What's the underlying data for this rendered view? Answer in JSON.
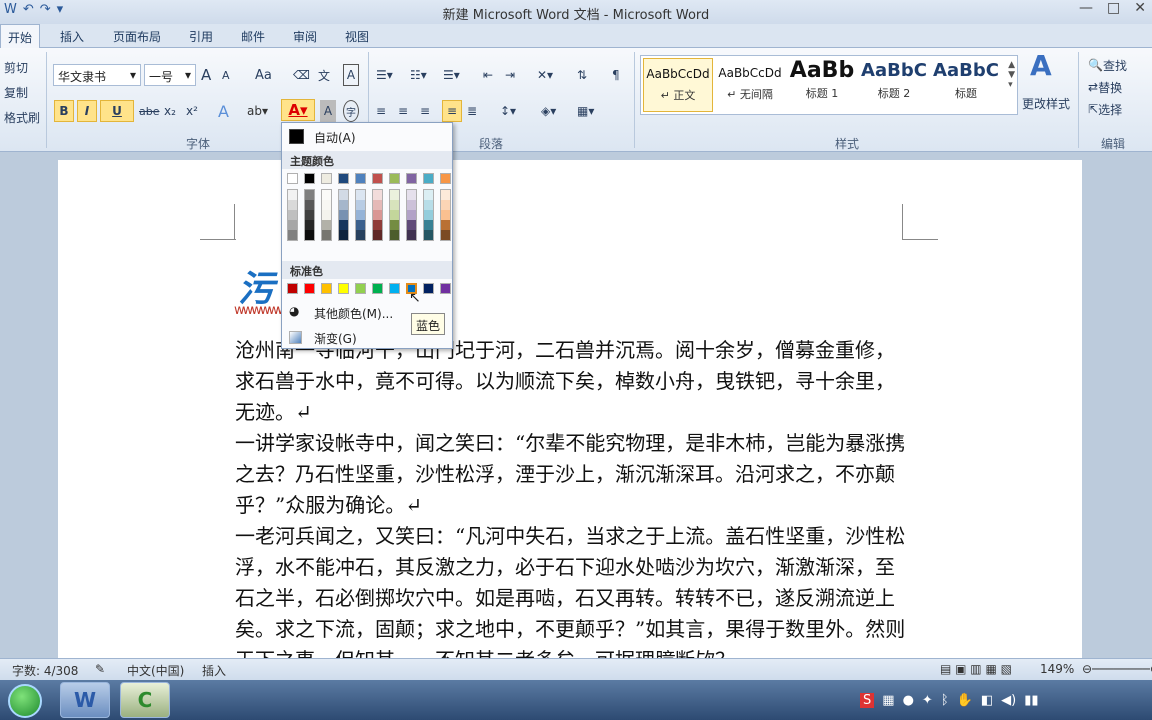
{
  "window": {
    "title": "新建 Microsoft Word 文档 - Microsoft Word"
  },
  "tabs": [
    "开始",
    "插入",
    "页面布局",
    "引用",
    "邮件",
    "审阅",
    "视图"
  ],
  "clipboard": {
    "cut": "剪切",
    "copy": "复制",
    "format_painter": "格式刷"
  },
  "font": {
    "name": "华文隶书",
    "size": "一号",
    "bold": "B",
    "italic": "I",
    "underline": "U",
    "strike": "abe",
    "sub": "x₂",
    "sup": "x²",
    "grow": "A",
    "shrink": "A",
    "case": "Aa",
    "group_label": "字体"
  },
  "paragraph": {
    "group_label": "段落"
  },
  "styles": {
    "items": [
      {
        "sample": "AaBbCcDd",
        "name": "↵ 正文"
      },
      {
        "sample": "AaBbCcDd",
        "name": "↵ 无间隔"
      },
      {
        "sample": "AaBb",
        "name": "标题 1"
      },
      {
        "sample": "AaBbC",
        "name": "标题 2"
      },
      {
        "sample": "AaBbC",
        "name": "标题"
      }
    ],
    "change_styles": "更改样式",
    "group_label": "样式"
  },
  "editing": {
    "find": "查找",
    "replace": "替换",
    "select": "选择",
    "group_label": "编辑"
  },
  "color_menu": {
    "auto": "自动(A)",
    "theme_title": "主题颜色",
    "standard_title": "标准色",
    "more": "其他颜色(M)...",
    "gradient": "渐变(G)",
    "tooltip": "蓝色",
    "theme_colors": [
      "#ffffff",
      "#000000",
      "#eeece1",
      "#1f497d",
      "#4f81bd",
      "#c0504d",
      "#9bbb59",
      "#8064a2",
      "#4bacc6",
      "#f79646"
    ],
    "standard_colors": [
      "#c00000",
      "#ff0000",
      "#ffc000",
      "#ffff00",
      "#92d050",
      "#00b050",
      "#00b0f0",
      "#0070c0",
      "#002060",
      "#7030a0"
    ]
  },
  "document": {
    "paragraphs": [
      "沧州南一寺临河干，山门圮于河，二石兽并沉焉。阅十余岁，僧募金重修，求石兽于水中，竟不可得。以为顺流下矣，棹数小舟，曳铁钯，寻十余里，无迹。↵",
      "一讲学家设帐寺中，闻之笑曰：“尔辈不能究物理，是非木杮，岂能为暴涨携之去？乃石性坚重，沙性松浮，湮于沙上，渐沉渐深耳。沿河求之，不亦颠乎？”众服为确论。↵",
      "一老河兵闻之，又笑曰：“凡河中失石，当求之于上流。盖石性坚重，沙性松浮，水不能冲石，其反激之力，必于石下迎水处啮沙为坎穴，渐激渐深，至石之半，石必倒掷坎穴中。如是再啮，石又再转。转转不已，遂反溯流逆上矣。求之下流，固颠；求之地中，不更颠乎？”如其言，果得于数里外。然则天下之事，但知其一，不知其二者多矣，可据理臆断欤？"
    ]
  },
  "status": {
    "words": "字数: 4/308",
    "lang": "中文(中国)",
    "insert": "插入",
    "zoom": "149%"
  }
}
